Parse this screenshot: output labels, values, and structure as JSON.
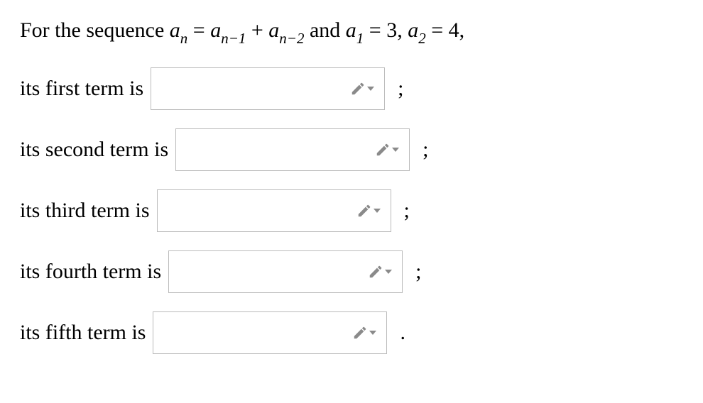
{
  "problem": {
    "prefix": "For the sequence ",
    "formula_lhs_a": "a",
    "formula_lhs_sub": "n",
    "eq": " = ",
    "formula_r1_a": "a",
    "formula_r1_sub": "n−1",
    "plus": " + ",
    "formula_r2_a": "a",
    "formula_r2_sub": "n−2",
    "and": " and ",
    "init1_a": "a",
    "init1_sub": "1",
    "init1_val": " = 3, ",
    "init2_a": "a",
    "init2_sub": "2",
    "init2_val": " = 4,"
  },
  "rows": [
    {
      "label": "its first term is",
      "punct": ";"
    },
    {
      "label": "its second term is",
      "punct": ";"
    },
    {
      "label": "its third term is",
      "punct": ";"
    },
    {
      "label": "its fourth term is",
      "punct": ";"
    },
    {
      "label": "its fifth term is",
      "punct": "."
    }
  ],
  "icons": {
    "pencil_color": "#8a8a8a",
    "caret_color": "#8a8a8a"
  }
}
